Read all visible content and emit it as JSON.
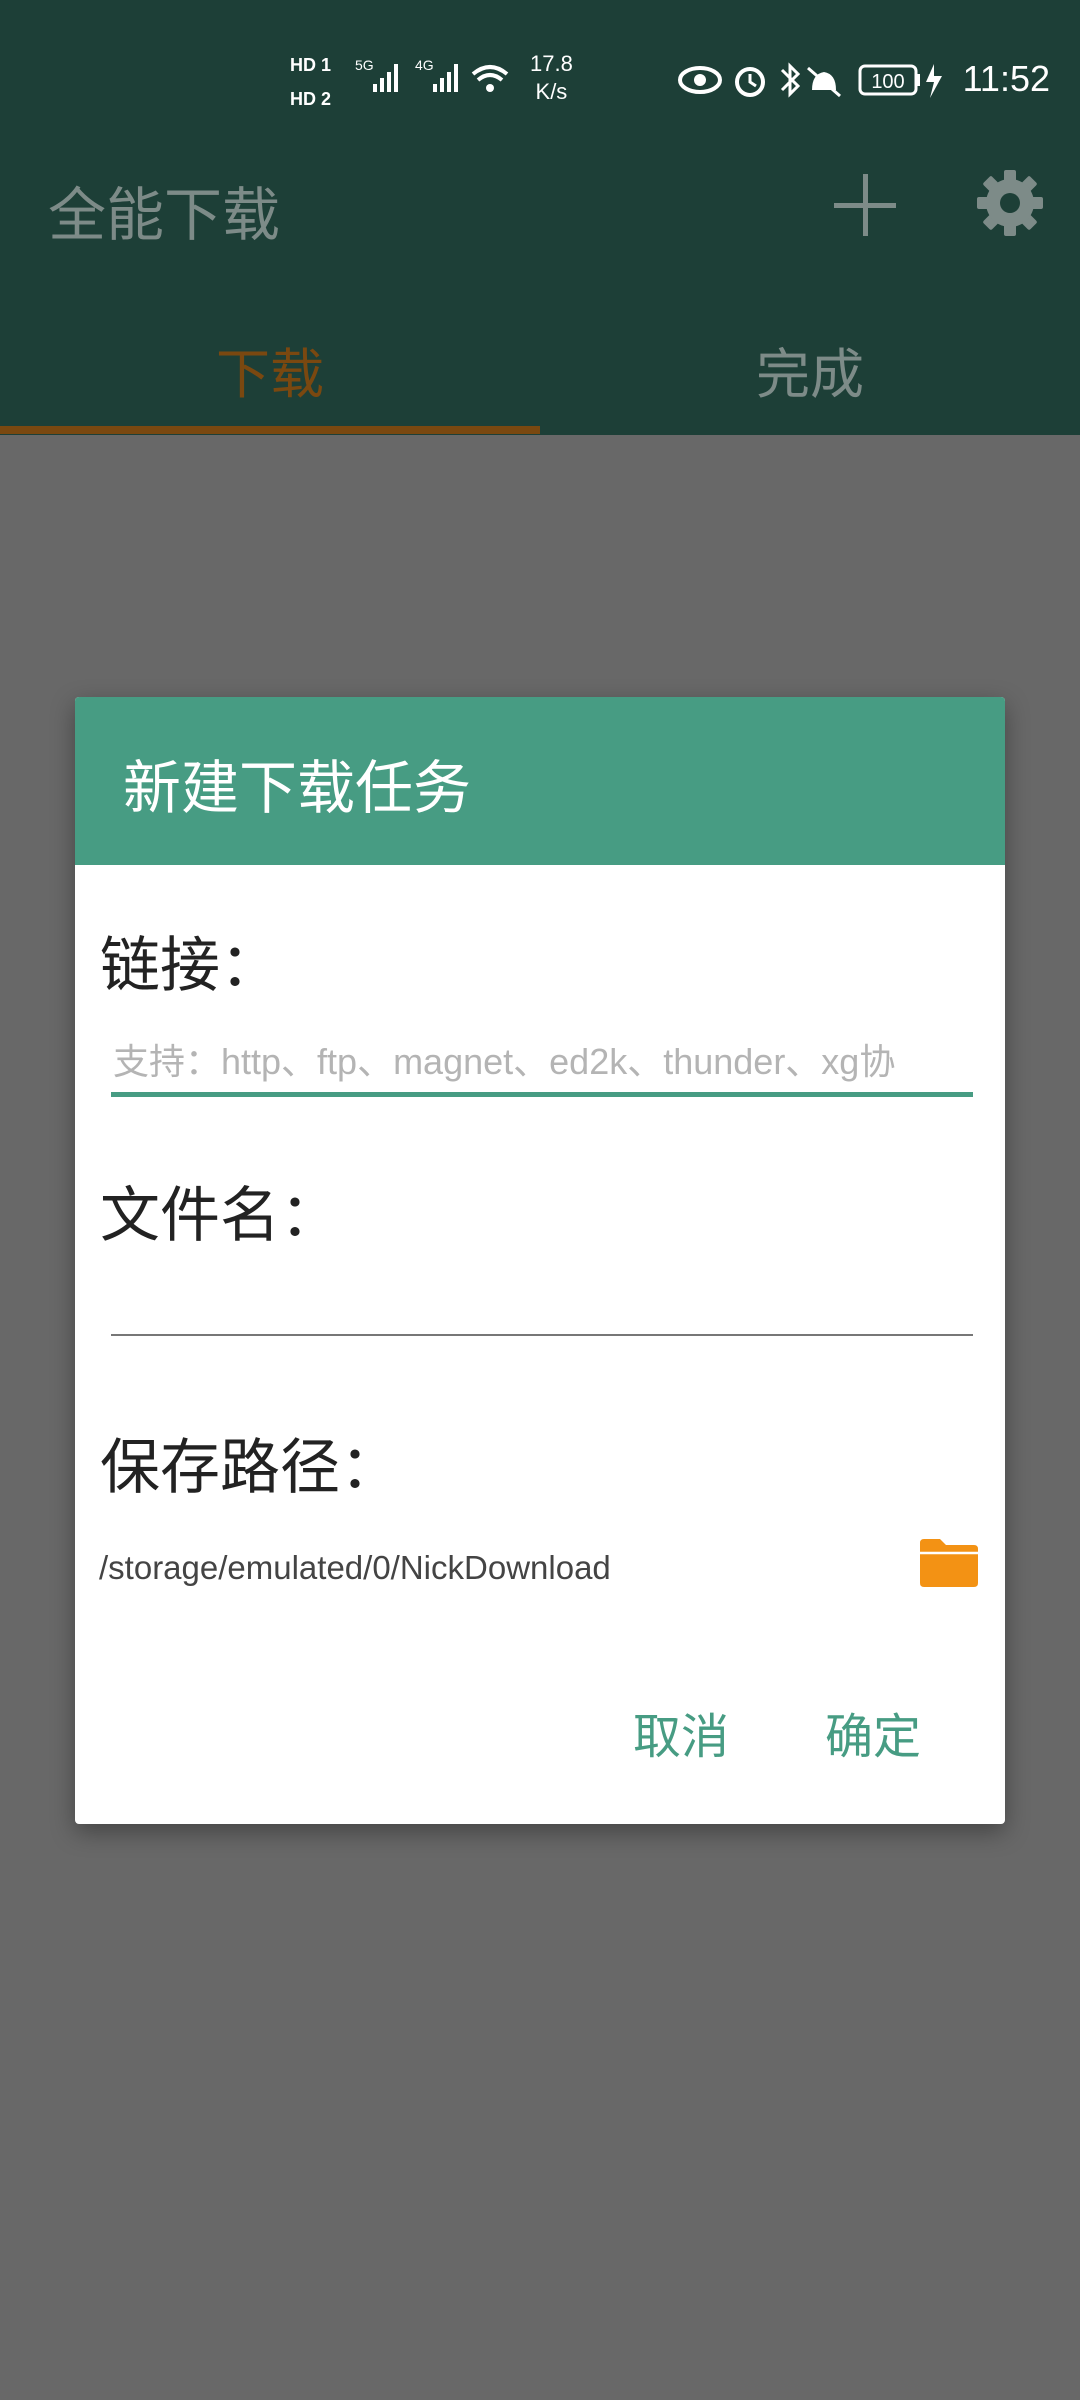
{
  "status_bar": {
    "sim1": "HD 1",
    "sim2": "HD 2",
    "net1": "5G",
    "net2": "4G",
    "speed_value": "17.8",
    "speed_unit": "K/s",
    "battery": "100",
    "time": "11:52"
  },
  "app_bar": {
    "title": "全能下载",
    "add_icon": "plus-icon",
    "settings_icon": "gear-icon"
  },
  "tabs": [
    {
      "label": "下载",
      "selected": true
    },
    {
      "label": "完成",
      "selected": false
    }
  ],
  "dialog": {
    "title": "新建下载任务",
    "link_label": "链接：",
    "link_placeholder": "支持：http、ftp、magnet、ed2k、thunder、xg协",
    "link_value": "",
    "filename_label": "文件名：",
    "filename_value": "",
    "path_label": "保存路径：",
    "path_value": "/storage/emulated/0/NickDownload",
    "folder_icon": "folder-icon",
    "cancel_label": "取消",
    "ok_label": "确定"
  },
  "colors": {
    "accent": "#479c83",
    "tab_indicator": "#e27f1d",
    "folder": "#f39214",
    "app_bar": "#1d3f37"
  }
}
